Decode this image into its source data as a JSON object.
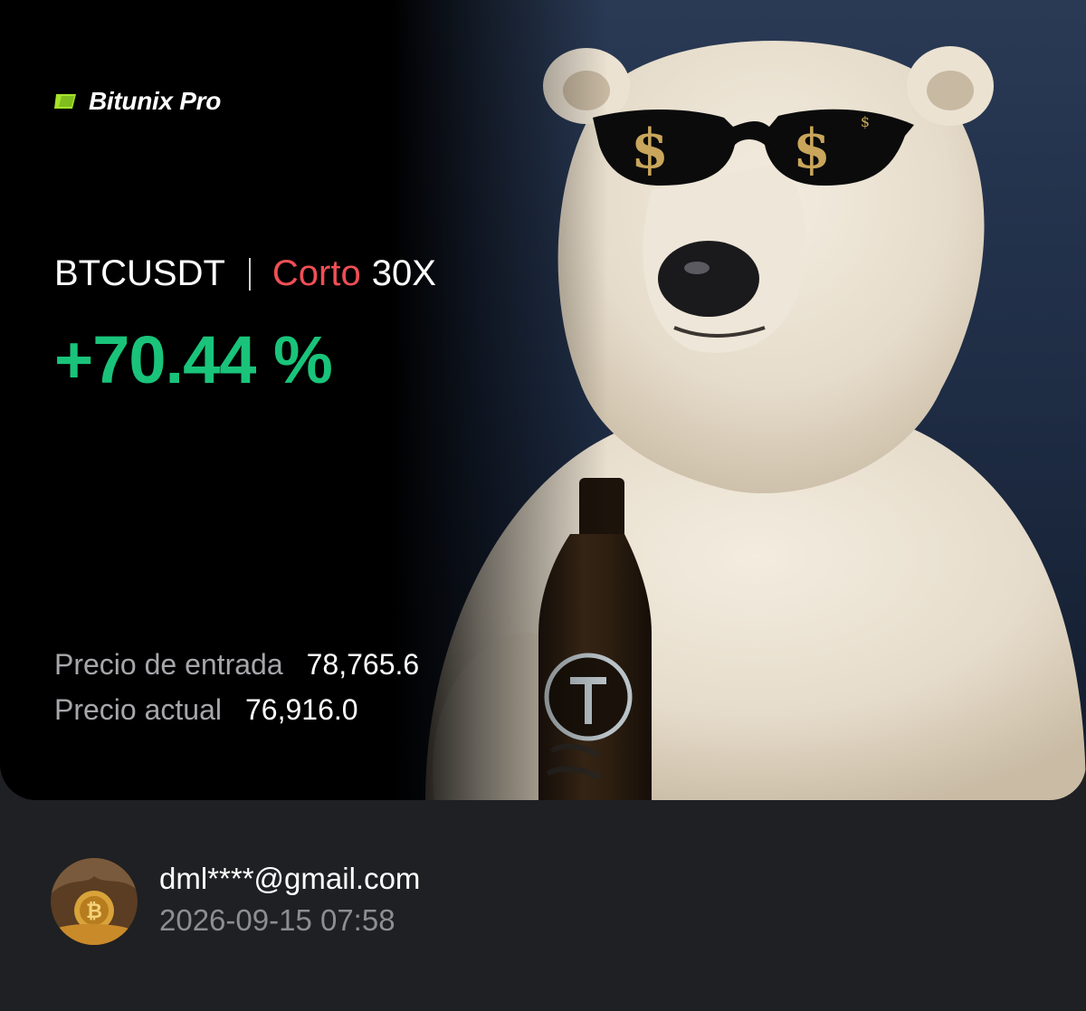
{
  "brand": {
    "name": "Bitunix Pro",
    "accent": "#a6e32b"
  },
  "position": {
    "pair": "BTCUSDT",
    "side": "Corto",
    "leverage": "30X",
    "pnl_percent": "+70.44 %"
  },
  "stats": {
    "entry_label": "Precio de entrada",
    "entry_value": "78,765.6",
    "current_label": "Precio actual",
    "current_value": "76,916.0"
  },
  "user": {
    "email": "dml****@gmail.com",
    "timestamp": "2026-09-15 07:58"
  },
  "colors": {
    "profit": "#19c47a",
    "short": "#ef4f55",
    "card_bg": "#050506",
    "page_bg": "#1f2023"
  }
}
